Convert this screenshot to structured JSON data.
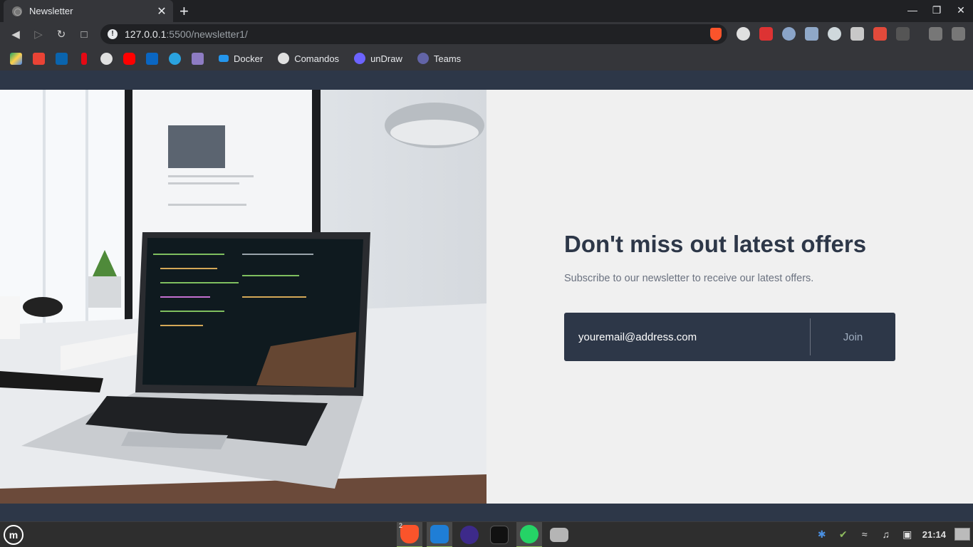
{
  "browser": {
    "tab_title": "Newsletter",
    "tab_close": "✕",
    "new_tab": "+",
    "url_host": "127.0.0.1",
    "url_rest": ":5500/newsletter1/",
    "info": "!"
  },
  "bookmarks": [
    {
      "label": "Docker"
    },
    {
      "label": "Comandos"
    },
    {
      "label": "unDraw"
    },
    {
      "label": "Teams"
    }
  ],
  "page": {
    "headline": "Don't miss out latest offers",
    "subtext": "Subscribe to our newsletter to receive our latest offers.",
    "email_placeholder": "youremail@address.com",
    "join_label": "Join"
  },
  "taskbar": {
    "clock": "21:14",
    "brave_badge": "2",
    "menu_glyph": "m"
  },
  "colors": {
    "page_bg": "#2d3748",
    "content_bg": "#f0f0f0",
    "headline": "#2d3748",
    "subtext": "#6b7280"
  }
}
